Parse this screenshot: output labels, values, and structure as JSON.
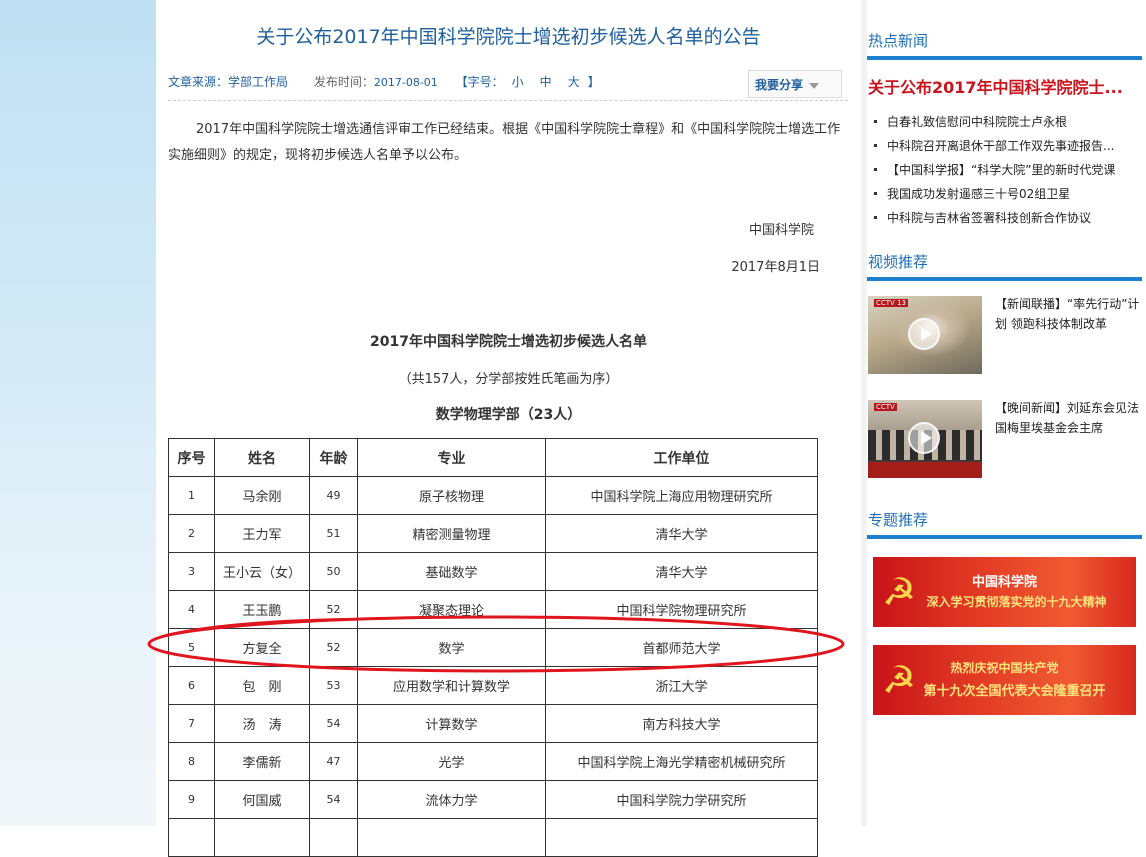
{
  "article": {
    "title": "关于公布2017年中国科学院院士增选初步候选人名单的公告",
    "source_label": "文章来源：",
    "source_value": "学部工作局",
    "date_label": "发布时间：",
    "date_value": "2017-08-01",
    "font_size_label": "【字号：",
    "font_small": "小",
    "font_medium": "中",
    "font_large": "大",
    "font_size_end": "】",
    "share_label": "我要分享",
    "paragraph": "2017年中国科学院院士增选通信评审工作已经结束。根据《中国科学院院士章程》和《中国科学院院士增选工作实施细则》的规定，现将初步候选人名单予以公布。",
    "signature_org": "中国科学院",
    "signature_date": "2017年8月1日",
    "list_title": "2017年中国科学院院士增选初步候选人名单",
    "list_subtitle": "（共157人，分学部按姓氏笔画为序）",
    "division_title": "数学物理学部（23人）"
  },
  "table": {
    "headers": [
      "序号",
      "姓名",
      "年龄",
      "专业",
      "工作单位"
    ],
    "rows": [
      [
        "1",
        "马余刚",
        "49",
        "原子核物理",
        "中国科学院上海应用物理研究所"
      ],
      [
        "2",
        "王力军",
        "51",
        "精密测量物理",
        "清华大学"
      ],
      [
        "3",
        "王小云（女）",
        "50",
        "基础数学",
        "清华大学"
      ],
      [
        "4",
        "王玉鹏",
        "52",
        "凝聚态理论",
        "中国科学院物理研究所"
      ],
      [
        "5",
        "方复全",
        "52",
        "数学",
        "首都师范大学"
      ],
      [
        "6",
        "包　刚",
        "53",
        "应用数学和计算数学",
        "浙江大学"
      ],
      [
        "7",
        "汤　涛",
        "54",
        "计算数学",
        "南方科技大学"
      ],
      [
        "8",
        "李儒新",
        "47",
        "光学",
        "中国科学院上海光学精密机械研究所"
      ],
      [
        "9",
        "何国威",
        "54",
        "流体力学",
        "中国科学院力学研究所"
      ]
    ]
  },
  "sidebar": {
    "hot_title": "热点新闻",
    "hot_headline": "关于公布2017年中国科学院院士...",
    "hot_items": [
      "白春礼致信慰问中科院院士卢永根",
      "中科院召开离退休干部工作双先事迹报告...",
      "【中国科学报】“科学大院”里的新时代党课",
      "我国成功发射遥感三十号02组卫星",
      "中科院与吉林省签署科技创新合作协议"
    ],
    "video_title": "视频推荐",
    "videos": [
      {
        "text": "【新闻联播】“率先行动”计划 领跑科技体制改革",
        "badge": "CCTV 13"
      },
      {
        "text": "【晚间新闻】刘延东会见法国梅里埃基金会主席",
        "badge": "CCTV"
      }
    ],
    "special_title": "专题推荐",
    "banners": [
      {
        "line1": "中国科学院",
        "line2": "深入学习贯彻落实党的十九大精神"
      },
      {
        "line1": "热烈庆祝中国共产党",
        "line2": "第十九次全国代表大会隆重召开"
      }
    ],
    "emblem_glyph": "☭"
  },
  "colors": {
    "link_blue": "#1f5f9e",
    "section_bar": "#1c7fd0",
    "headline_red": "#c8141c",
    "oval_red": "#e0161e"
  }
}
